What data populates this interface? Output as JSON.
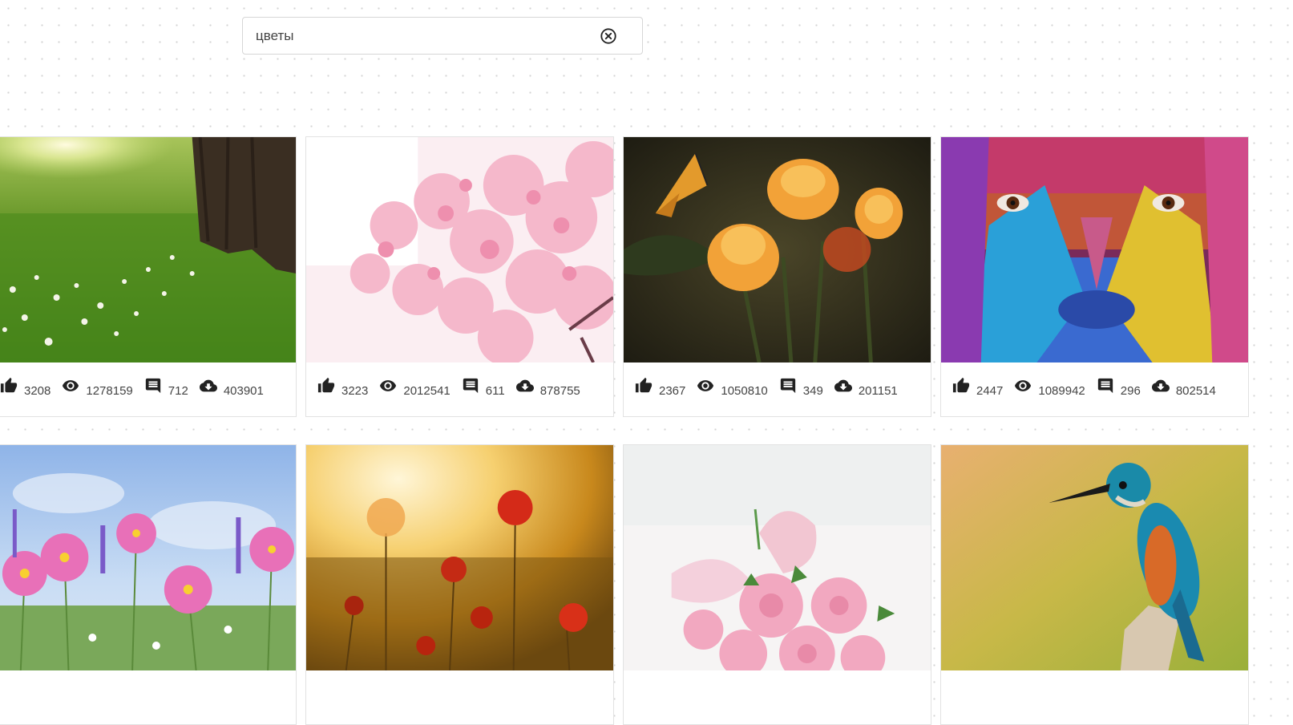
{
  "search": {
    "value": "цветы"
  },
  "icons": {
    "clear": "close-circle-icon",
    "likes": "thumb-up-icon",
    "views": "eye-icon",
    "comments": "comment-icon",
    "downloads": "cloud-download-icon"
  },
  "cards": [
    {
      "subject": "meadow with tree and white flowers",
      "likes": "3208",
      "views": "1278159",
      "comments": "712",
      "downloads": "403901"
    },
    {
      "subject": "pink cherry blossoms",
      "likes": "3223",
      "views": "2012541",
      "comments": "611",
      "downloads": "878755"
    },
    {
      "subject": "orange flowers with butterfly",
      "likes": "2367",
      "views": "1050810",
      "comments": "349",
      "downloads": "201151"
    },
    {
      "subject": "face painted in bright colors",
      "likes": "2447",
      "views": "1089942",
      "comments": "296",
      "downloads": "802514"
    },
    {
      "subject": "pink cosmos flowers under blue sky"
    },
    {
      "subject": "red poppies at sunset"
    },
    {
      "subject": "pink ranunculus bouquet"
    },
    {
      "subject": "kingfisher on a branch"
    }
  ]
}
